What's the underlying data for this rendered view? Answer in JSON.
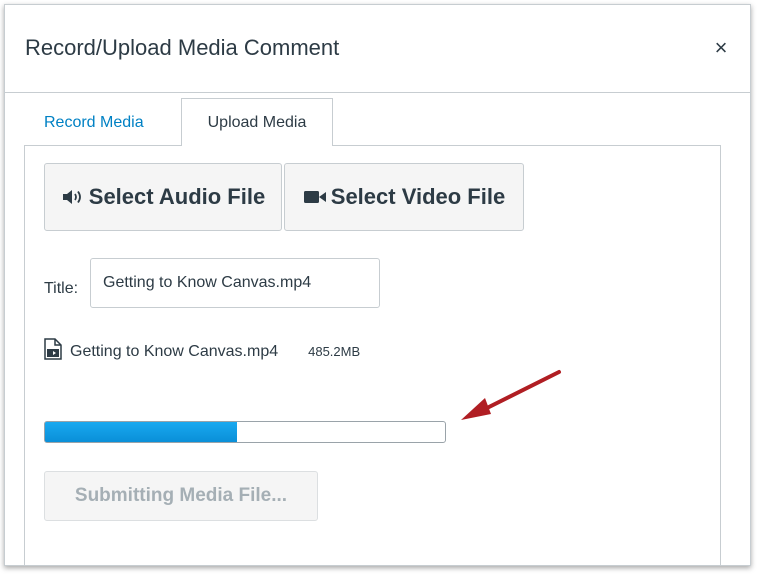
{
  "dialog": {
    "title": "Record/Upload Media Comment",
    "close_label": "×"
  },
  "tabs": [
    {
      "label": "Record Media",
      "active": false
    },
    {
      "label": "Upload Media",
      "active": true
    }
  ],
  "buttons": {
    "select_audio": {
      "label": "Select Audio File",
      "icon": "speaker-icon"
    },
    "select_video": {
      "label": "Select Video File",
      "icon": "video-camera-icon"
    },
    "submit": {
      "label": "Submitting Media File...",
      "disabled": true
    }
  },
  "title_field": {
    "label": "Title:",
    "value": "Getting to Know Canvas.mp4"
  },
  "file": {
    "icon": "video-file-icon",
    "name": "Getting to Know Canvas.mp4",
    "size": "485.2MB"
  },
  "upload_progress": 0.48,
  "colors": {
    "link": "#0081c4",
    "progress": "#0099e6",
    "annotation_arrow": "#b01e23"
  }
}
